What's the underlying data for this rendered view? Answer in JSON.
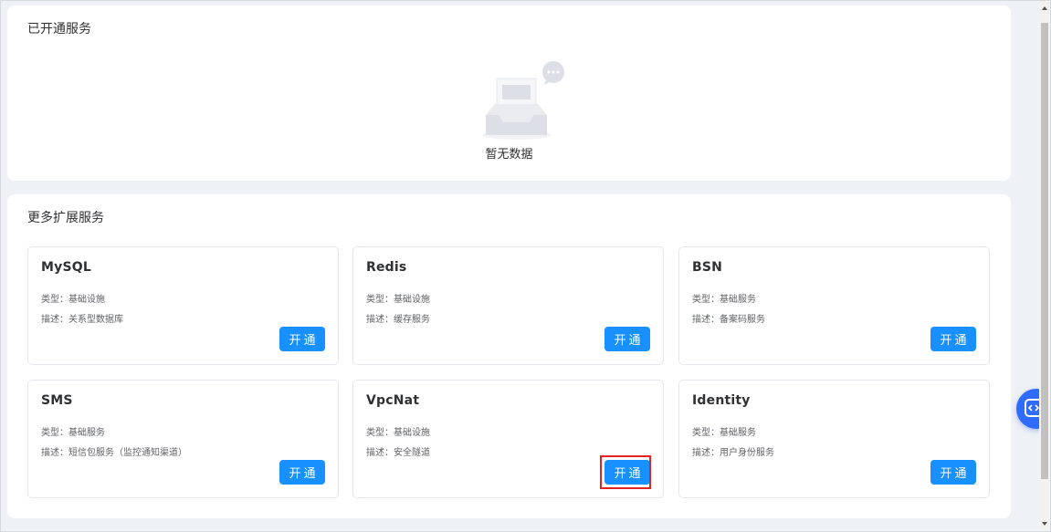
{
  "active_services": {
    "title": "已开通服务",
    "empty_text": "暂无数据"
  },
  "more_services": {
    "title": "更多扩展服务",
    "cards": [
      {
        "name": "MySQL",
        "type": "类型：基础设施",
        "desc": "描述：关系型数据库",
        "button": "开通"
      },
      {
        "name": "Redis",
        "type": "类型：基础设施",
        "desc": "描述：缓存服务",
        "button": "开通"
      },
      {
        "name": "BSN",
        "type": "类型：基础服务",
        "desc": "描述：备案码服务",
        "button": "开通"
      },
      {
        "name": "SMS",
        "type": "类型：基础服务",
        "desc": "描述：短信包服务（监控通知渠道）",
        "button": "开通"
      },
      {
        "name": "VpcNat",
        "type": "类型：基础设施",
        "desc": "描述：安全隧道",
        "button": "开通"
      },
      {
        "name": "Identity",
        "type": "类型：基础服务",
        "desc": "描述：用户身份服务",
        "button": "开通"
      }
    ]
  },
  "colors": {
    "accent": "#1890ff",
    "highlight": "#e32222",
    "page_bg": "#eef1f6"
  },
  "icons": {
    "empty": "empty-inbox-icon",
    "float_tool": "code-tool-icon"
  }
}
